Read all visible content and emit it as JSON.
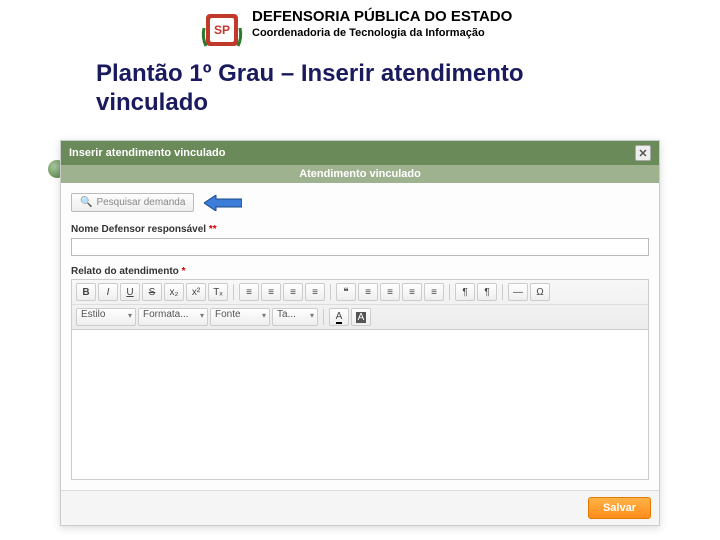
{
  "header": {
    "org_title": "DEFENSORIA PÚBLICA DO ESTADO",
    "org_subtitle": "Coordenadoria de Tecnologia da Informação"
  },
  "page": {
    "title_line1": "Plantão 1º Grau – Inserir atendimento",
    "title_line2": "vinculado"
  },
  "modal": {
    "title": "Inserir atendimento vinculado",
    "section_header": "Atendimento vinculado",
    "search_button": "Pesquisar demanda",
    "defender_label": "Nome Defensor responsável",
    "defender_required": "**",
    "defender_value": "",
    "report_label": "Relato do atendimento",
    "report_required": "*",
    "save_button": "Salvar"
  },
  "toolbar": {
    "row1": {
      "bold": "B",
      "italic": "I",
      "underline": "U",
      "strike": "S",
      "sub": "x₂",
      "sup": "x²",
      "clear": "Tₓ",
      "ol": "≡",
      "ul": "≡",
      "outdent": "≡",
      "indent": "≡",
      "quote": "❝",
      "center": "≡",
      "block": "≡",
      "left": "≡",
      "right": "≡",
      "ltr": "¶",
      "rtl": "¶",
      "hr": "—",
      "omega": "Ω"
    },
    "row2": {
      "style": "Estilo",
      "format": "Formata...",
      "font": "Fonte",
      "size": "Ta...",
      "textcolor": "A",
      "bgcolor": "A"
    }
  }
}
